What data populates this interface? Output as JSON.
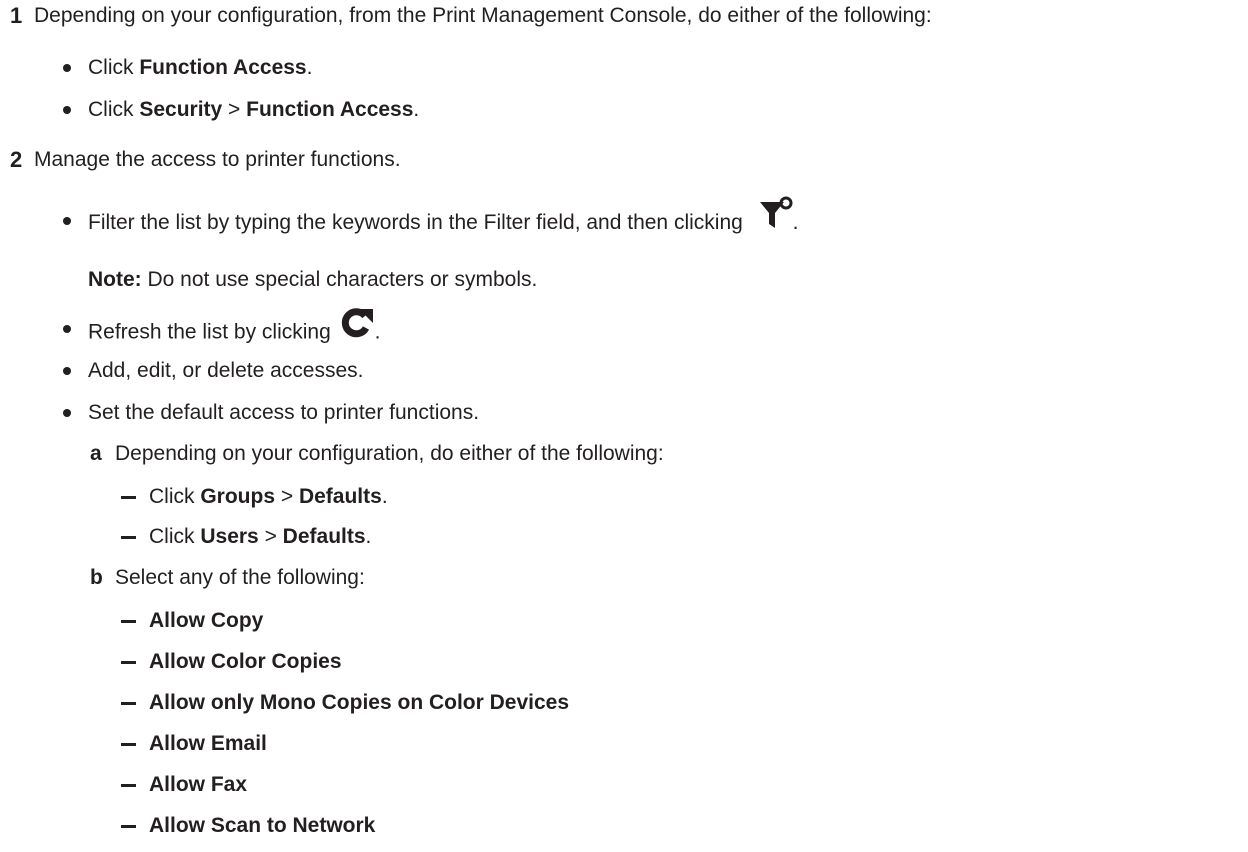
{
  "step1": {
    "number": "1",
    "text": "Depending on your configuration, from the Print Management Console, do either of the following:",
    "options": [
      {
        "prefix": "Click ",
        "bold1": "Function Access",
        "sep": "",
        "bold2": "",
        "suffix": "."
      },
      {
        "prefix": "Click ",
        "bold1": "Security",
        "sep": " > ",
        "bold2": "Function Access",
        "suffix": "."
      }
    ]
  },
  "step2": {
    "number": "2",
    "text": "Manage the access to printer functions.",
    "filter_text": "Filter the list by typing the keywords in the Filter field, and then clicking",
    "filter_icon": "filter-icon",
    "note_label": "Note:",
    "note_text": " Do not use special characters or symbols.",
    "refresh_text": "Refresh the list by clicking",
    "refresh_icon": "refresh-icon",
    "add_text": "Add, edit, or delete accesses.",
    "default_text": "Set the default access to printer functions.",
    "substep_a": {
      "letter": "a",
      "text": "Depending on your configuration, do either of the following:",
      "items": [
        {
          "prefix": "Click ",
          "bold1": "Groups",
          "sep": " > ",
          "bold2": "Defaults",
          "suffix": "."
        },
        {
          "prefix": "Click ",
          "bold1": "Users",
          "sep": " > ",
          "bold2": "Defaults",
          "suffix": "."
        }
      ]
    },
    "substep_b": {
      "letter": "b",
      "text": "Select any of the following:",
      "items": [
        "Allow Copy",
        "Allow Color Copies",
        "Allow only Mono Copies on Color Devices",
        "Allow Email",
        "Allow Fax",
        "Allow Scan to Network"
      ]
    },
    "punct": "."
  }
}
